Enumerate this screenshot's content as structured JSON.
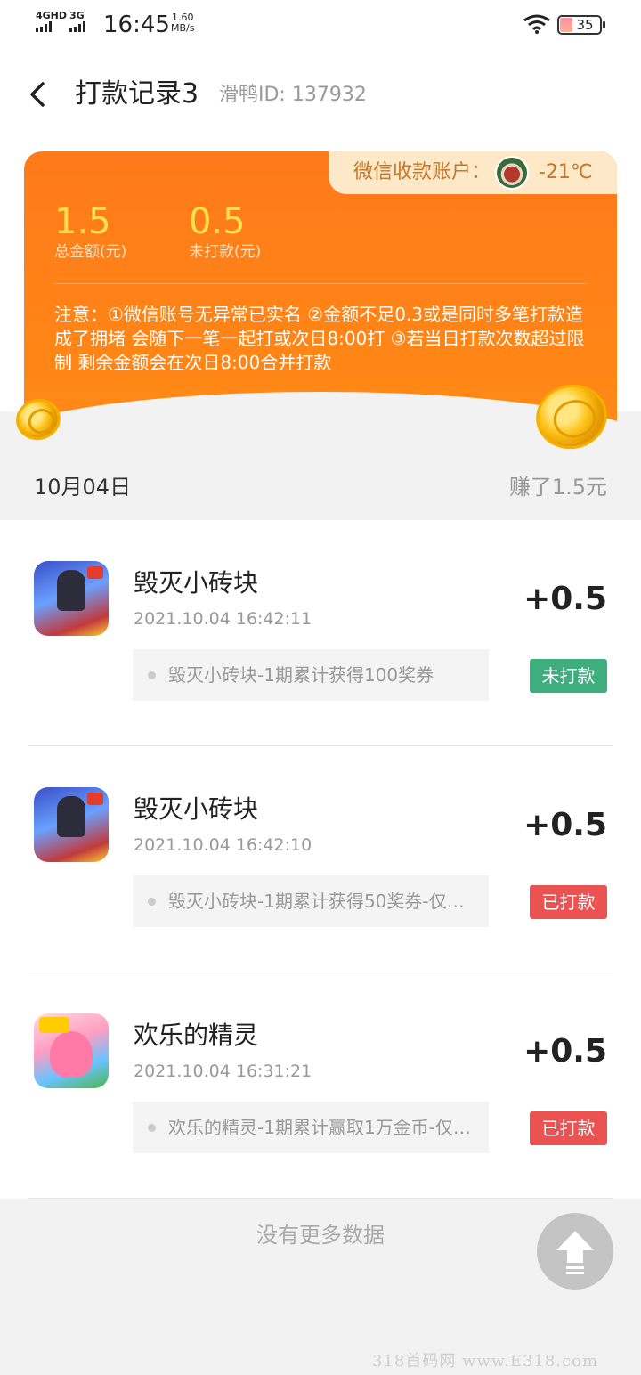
{
  "status_bar": {
    "network1": "4GHD",
    "network2": "3G",
    "time": "16:45",
    "speed_value": "1.60",
    "speed_unit": "MB/s",
    "battery": "35"
  },
  "header": {
    "title": "打款记录3",
    "user_id": "滑鸭ID: 137932"
  },
  "summary": {
    "wechat_label": "微信收款账户：",
    "wechat_name": "-21℃",
    "total_amount": "1.5",
    "total_label": "总金额(元)",
    "unpaid_amount": "0.5",
    "unpaid_label": "未打款(元)",
    "notice": "注意：①微信账号无异常已实名 ②金额不足0.3或是同时多笔打款造成了拥堵 会随下一笔一起打或次日8:00打 ③若当日打款次数超过限制 剩余金额会在次日8:00合并打款"
  },
  "date_group": {
    "date": "10月04日",
    "earned": "赚了1.5元"
  },
  "records": [
    {
      "app": "毁灭小砖块",
      "time": "2021.10.04 16:42:11",
      "amount": "+0.5",
      "desc": "毁灭小砖块-1期累计获得100奖券",
      "status": "未打款"
    },
    {
      "app": "毁灭小砖块",
      "time": "2021.10.04 16:42:10",
      "amount": "+0.5",
      "desc": "毁灭小砖块-1期累计获得50奖券-仅…",
      "status": "已打款"
    },
    {
      "app": "欢乐的精灵",
      "time": "2021.10.04 16:31:21",
      "amount": "+0.5",
      "desc": "欢乐的精灵-1期累计赢取1万金币-仅…",
      "status": "已打款"
    }
  ],
  "footer": {
    "no_more": "没有更多数据"
  },
  "watermark": "318首码网 www.E318.com",
  "colors": {
    "accent_orange": "#ff7a1a",
    "amount_yellow": "#ffe14d",
    "unpaid_green": "#3fae7f",
    "paid_red": "#eb5353"
  },
  "icons": [
    "back-arrow-icon",
    "wifi-icon",
    "battery-icon",
    "scroll-to-top-icon",
    "coin-icon"
  ]
}
